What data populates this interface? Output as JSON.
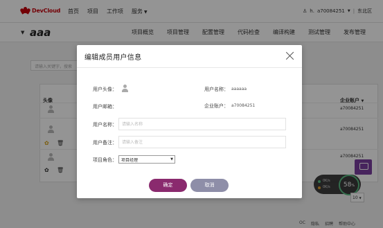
{
  "topbar": {
    "brand": "DevCloud",
    "nav": [
      {
        "label": "首页"
      },
      {
        "label": "项目"
      },
      {
        "label": "工作项"
      },
      {
        "label": "服务"
      }
    ],
    "user_name": "h.",
    "account_id": "a70084251",
    "region": "东北区"
  },
  "project": {
    "name": "aaa",
    "tabs": [
      "项目概览",
      "项目管理",
      "配置管理",
      "代码检查",
      "编译构建",
      "测试管理",
      "发布管理"
    ]
  },
  "background": {
    "search_placeholder": "请输入关键字，搜索",
    "table_headers": {
      "avatar": "头像",
      "corp_account": "企业账户"
    },
    "rows": [
      {
        "corp_account": "a70084251"
      },
      {
        "corp_account": "a70084251"
      },
      {
        "corp_account": "a70084251"
      }
    ],
    "page_size": "10",
    "speed": {
      "value": "58",
      "unit": "%",
      "up": "0K/s",
      "down": "0K/s"
    },
    "footer_links": [
      "OC",
      "隐私",
      "招聘",
      "帮助中心"
    ]
  },
  "modal": {
    "title": "编辑成员用户信息",
    "labels": {
      "avatar": "用户头像：",
      "username": "用户名称：",
      "email": "用户邮箱：",
      "corp_account": "企业账户：",
      "nickname": "用户名称：",
      "remark": "用户备注：",
      "role": "项目角色："
    },
    "values": {
      "username": "aaaaaa",
      "corp_account": "a70084251"
    },
    "nickname_placeholder": "请输入名称",
    "remark_placeholder": "请输入备注",
    "role_selected": "项目经理",
    "confirm_label": "确定",
    "cancel_label": "取消"
  },
  "colors": {
    "brand_red": "#c7000b",
    "confirm_btn": "#8a2a6e",
    "cancel_btn": "#8e8ea8",
    "chat_btn": "#7b3fa1"
  }
}
